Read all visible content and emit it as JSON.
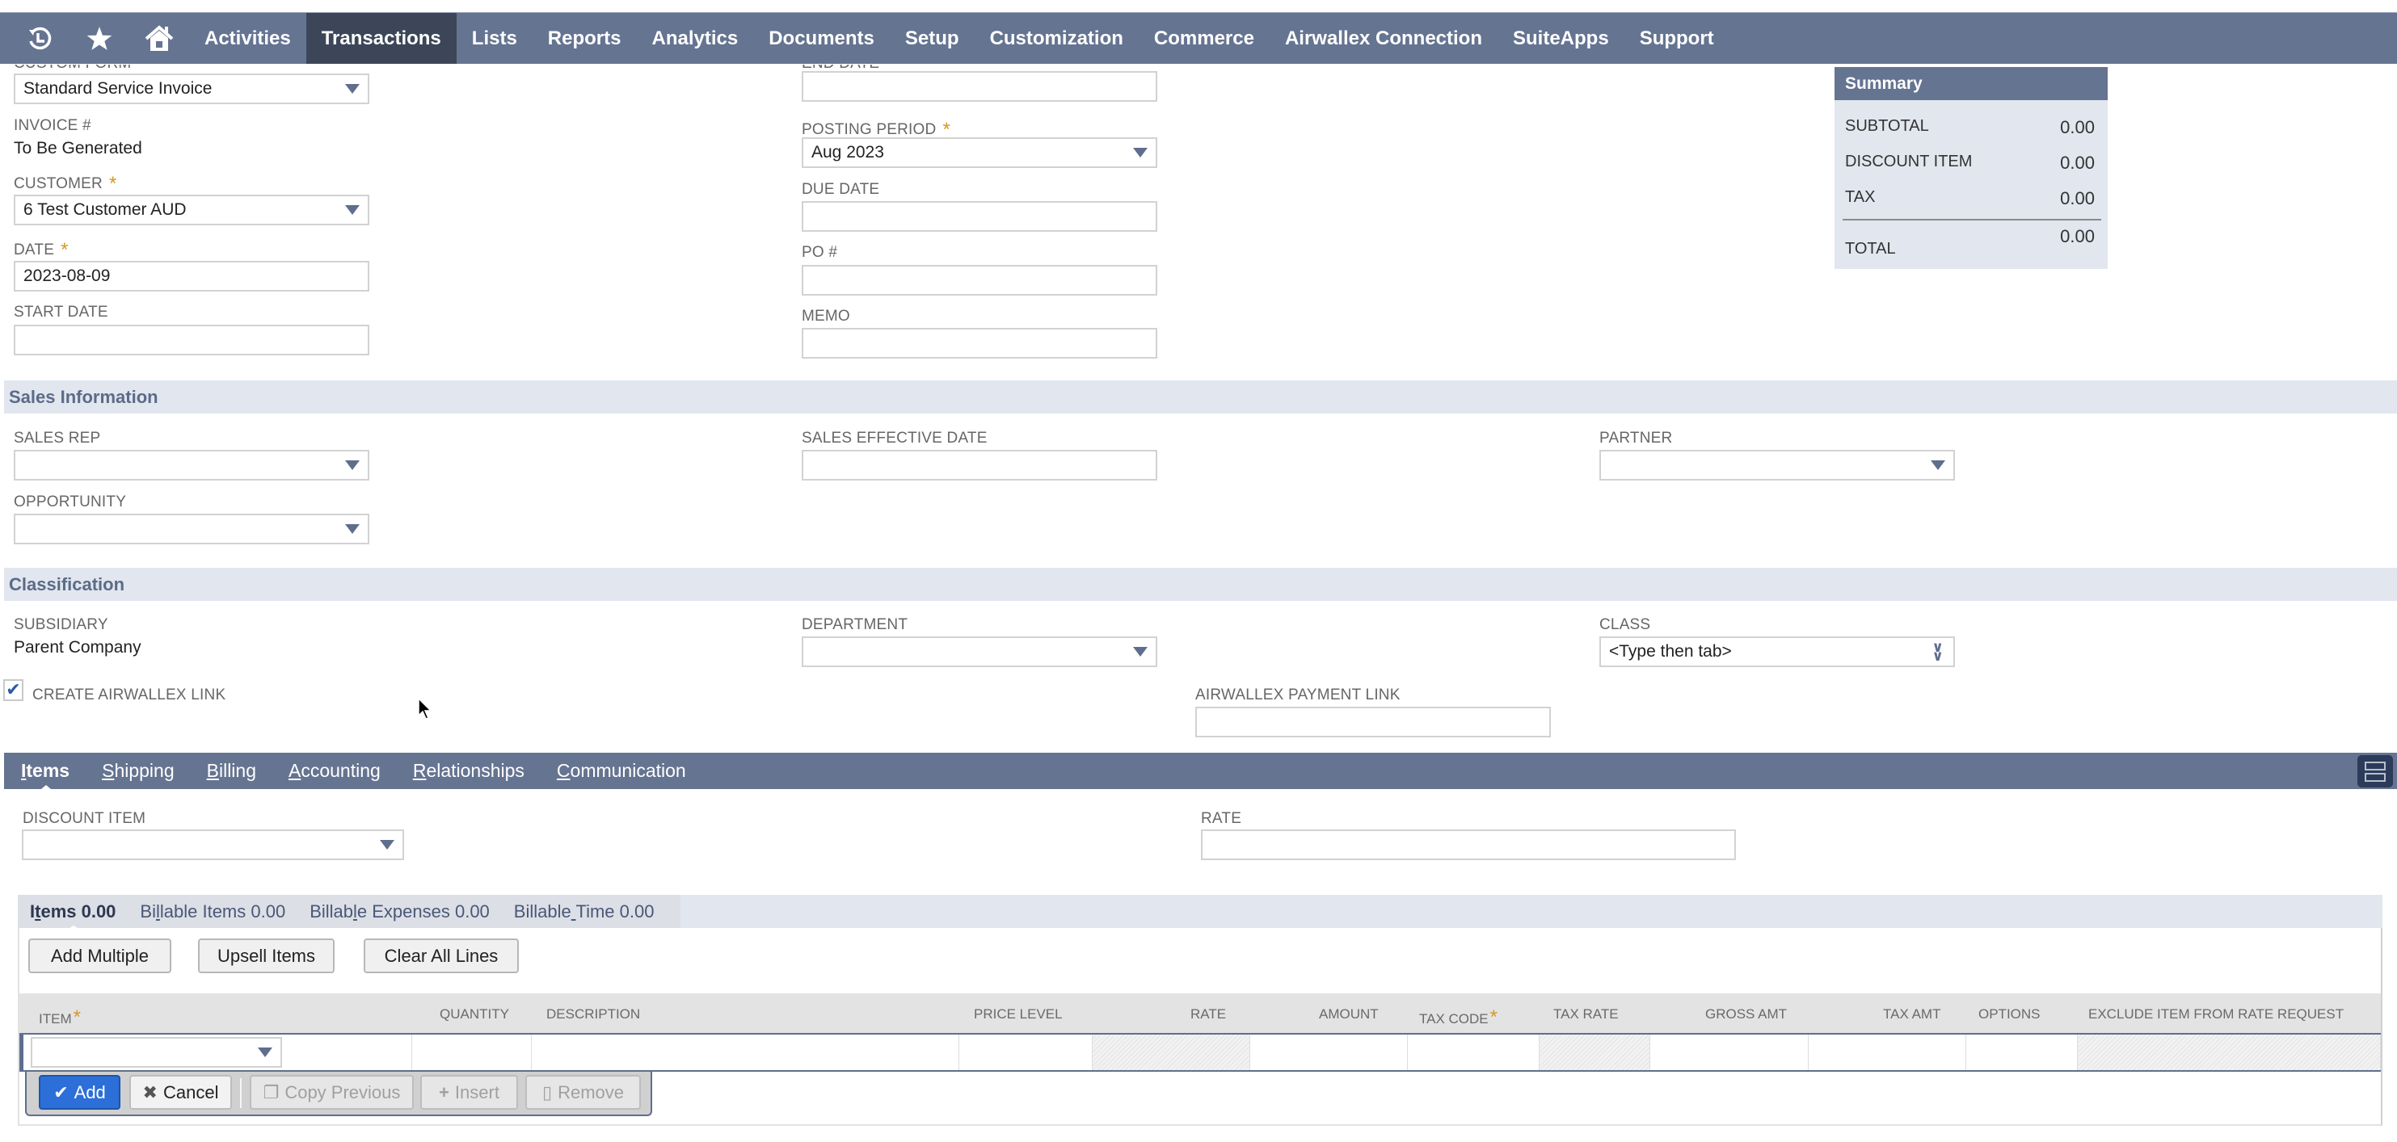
{
  "nav": {
    "icons": [
      "recent-records-icon",
      "favorites-star-icon",
      "home-icon"
    ],
    "items": [
      "Activities",
      "Transactions",
      "Lists",
      "Reports",
      "Analytics",
      "Documents",
      "Setup",
      "Customization",
      "Commerce",
      "Airwallex Connection",
      "SuiteApps",
      "Support"
    ],
    "active": "Transactions"
  },
  "primary": {
    "custom_form": {
      "label": "CUSTOM FORM",
      "value": "Standard Service Invoice"
    },
    "invoice_number": {
      "label": "INVOICE #",
      "value": "To Be Generated"
    },
    "customer": {
      "label": "CUSTOMER",
      "value": "6 Test Customer AUD",
      "required": true
    },
    "date": {
      "label": "DATE",
      "value": "2023-08-09",
      "required": true
    },
    "start_date": {
      "label": "START DATE",
      "value": ""
    },
    "end_date": {
      "label": "END DATE",
      "value": ""
    },
    "posting_period": {
      "label": "POSTING PERIOD",
      "value": "Aug 2023",
      "required": true
    },
    "due_date": {
      "label": "DUE DATE",
      "value": ""
    },
    "po_number": {
      "label": "PO #",
      "value": ""
    },
    "memo": {
      "label": "MEMO",
      "value": ""
    }
  },
  "summary": {
    "title": "Summary",
    "rows": [
      {
        "label": "SUBTOTAL",
        "value": "0.00"
      },
      {
        "label": "DISCOUNT ITEM",
        "value": "0.00"
      },
      {
        "label": "TAX",
        "value": "0.00"
      }
    ],
    "total": {
      "label": "TOTAL",
      "value": "0.00"
    }
  },
  "sales_info": {
    "title": "Sales Information",
    "sales_rep": {
      "label": "SALES REP",
      "value": ""
    },
    "sales_effective_date": {
      "label": "SALES EFFECTIVE DATE",
      "value": ""
    },
    "partner": {
      "label": "PARTNER",
      "value": ""
    },
    "opportunity": {
      "label": "OPPORTUNITY",
      "value": ""
    }
  },
  "classification": {
    "title": "Classification",
    "subsidiary": {
      "label": "SUBSIDIARY",
      "value": "Parent Company"
    },
    "department": {
      "label": "DEPARTMENT",
      "value": ""
    },
    "class": {
      "label": "CLASS",
      "value": "<Type then tab>"
    },
    "create_airwallex_link": {
      "label": "CREATE AIRWALLEX LINK",
      "checked": true
    },
    "airwallex_payment_link": {
      "label": "AIRWALLEX PAYMENT LINK",
      "value": ""
    }
  },
  "subtabs": {
    "items": [
      {
        "accesskey": "I",
        "rest": "tems"
      },
      {
        "accesskey": "S",
        "rest": "hipping"
      },
      {
        "accesskey": "B",
        "rest": "illing"
      },
      {
        "accesskey": "A",
        "rest": "ccounting"
      },
      {
        "accesskey": "R",
        "rest": "elationships"
      },
      {
        "accesskey": "C",
        "rest": "ommunication"
      }
    ],
    "active": "Items"
  },
  "items_tab": {
    "discount_item": {
      "label": "DISCOUNT ITEM",
      "value": ""
    },
    "rate": {
      "label": "RATE",
      "value": ""
    },
    "machine_tabs": [
      {
        "pre": "I",
        "u": "t",
        "post": "ems 0.00"
      },
      {
        "pre": "Bi",
        "u": "l",
        "post": "lable Items 0.00"
      },
      {
        "pre": "Billab",
        "u": "l",
        "post": "e Expenses 0.00"
      },
      {
        "pre": "Billable",
        "u": " ",
        "post": "Time 0.00"
      }
    ],
    "buttons": [
      "Add Multiple",
      "Upsell Items",
      "Clear All Lines"
    ],
    "columns": [
      "ITEM",
      "QUANTITY",
      "DESCRIPTION",
      "PRICE LEVEL",
      "RATE",
      "AMOUNT",
      "TAX CODE",
      "TAX RATE",
      "GROSS AMT",
      "TAX AMT",
      "OPTIONS",
      "EXCLUDE ITEM FROM RATE REQUEST"
    ],
    "line_actions": {
      "add": "Add",
      "cancel": "Cancel",
      "copy_previous": "Copy Previous",
      "insert": "Insert",
      "remove": "Remove"
    }
  },
  "colors": {
    "nav_bg": "#657491",
    "nav_active": "#3c4658",
    "section_bg": "#e1e6ef",
    "required_star": "#d39a26",
    "primary_button": "#2d6fd8"
  }
}
